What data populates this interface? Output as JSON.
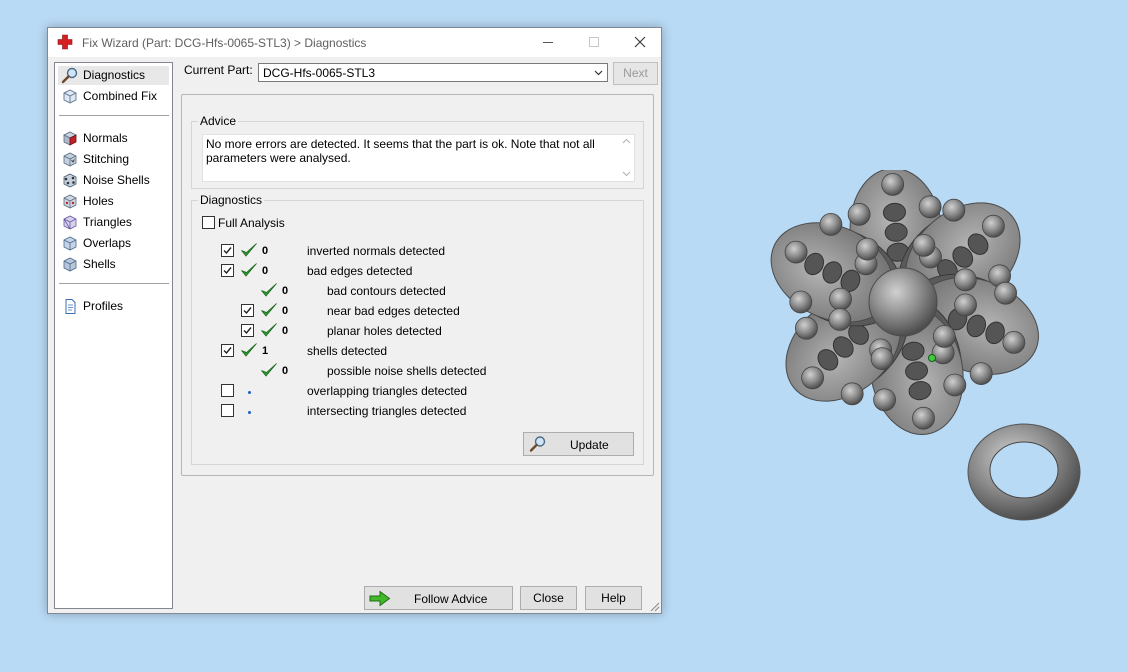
{
  "window": {
    "title": "Fix Wizard (Part: DCG-Hfs-0065-STL3) > Diagnostics",
    "minimize_icon": "minimize-icon",
    "maximize_icon": "maximize-icon",
    "close_icon": "close-icon"
  },
  "nav": {
    "items": [
      {
        "label": "Diagnostics",
        "icon": "magnifier-icon",
        "selected": true
      },
      {
        "label": "Combined Fix",
        "icon": "cube-icon"
      },
      {
        "label": "Normals",
        "icon": "cube-red-face-icon"
      },
      {
        "label": "Stitching",
        "icon": "stitching-cube-icon"
      },
      {
        "label": "Noise Shells",
        "icon": "noise-shells-icon"
      },
      {
        "label": "Holes",
        "icon": "cube-holes-icon"
      },
      {
        "label": "Triangles",
        "icon": "triangle-cube-icon"
      },
      {
        "label": "Overlaps",
        "icon": "overlap-cube-icon"
      },
      {
        "label": "Shells",
        "icon": "shell-cube-icon"
      },
      {
        "label": "Profiles",
        "icon": "document-icon"
      }
    ]
  },
  "header": {
    "current_part_label": "Current Part:",
    "current_part_value": "DCG-Hfs-0065-STL3",
    "next_label": "Next"
  },
  "advice": {
    "title": "Advice",
    "text": "No more errors are detected. It seems that the part is ok. Note that not all parameters were analysed."
  },
  "diagnostics": {
    "title": "Diagnostics",
    "full_analysis_label": "Full Analysis",
    "full_analysis_checked": false,
    "rows": [
      {
        "checkbox": true,
        "checked": true,
        "status": "ok",
        "count": "0",
        "label": "inverted normals detected",
        "indent": 0
      },
      {
        "checkbox": true,
        "checked": true,
        "status": "ok",
        "count": "0",
        "label": "bad edges detected",
        "indent": 0
      },
      {
        "checkbox": false,
        "checked": false,
        "status": "ok",
        "count": "0",
        "label": "bad contours detected",
        "indent": 1
      },
      {
        "checkbox": true,
        "checked": true,
        "status": "ok",
        "count": "0",
        "label": "near bad edges detected",
        "indent": 1
      },
      {
        "checkbox": true,
        "checked": true,
        "status": "ok",
        "count": "0",
        "label": "planar holes detected",
        "indent": 1
      },
      {
        "checkbox": true,
        "checked": true,
        "status": "ok",
        "count": "1",
        "label": "shells detected",
        "indent": 0
      },
      {
        "checkbox": false,
        "checked": false,
        "status": "ok",
        "count": "0",
        "label": "possible noise shells detected",
        "indent": 1
      },
      {
        "checkbox": true,
        "checked": false,
        "status": "pending",
        "count": "",
        "label": "overlapping triangles detected",
        "indent": 0
      },
      {
        "checkbox": true,
        "checked": false,
        "status": "pending",
        "count": "",
        "label": "intersecting triangles detected",
        "indent": 0
      }
    ],
    "update_label": "Update"
  },
  "footer": {
    "follow_advice_label": "Follow Advice",
    "close_label": "Close",
    "help_label": "Help"
  },
  "colors": {
    "tick_green": "#2e9a2e",
    "desktop": "#b9daf5",
    "model_gray": "#8c8c8c"
  }
}
